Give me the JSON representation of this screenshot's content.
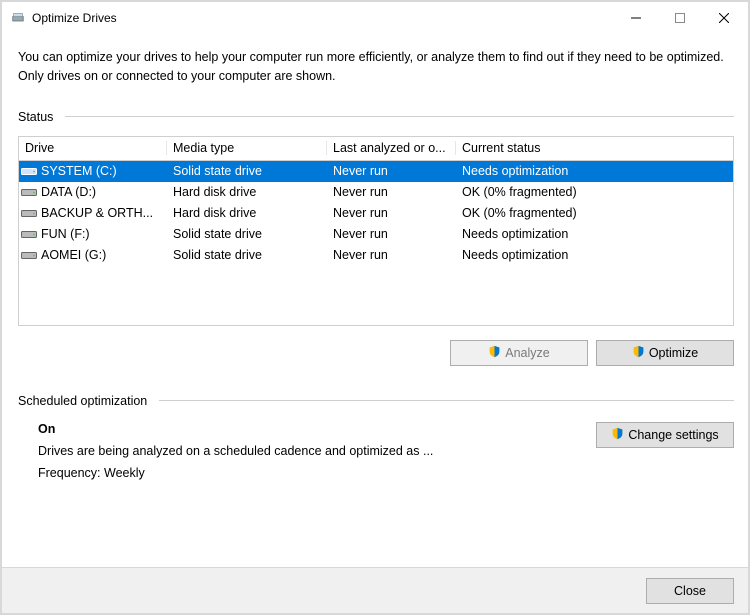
{
  "window": {
    "title": "Optimize Drives"
  },
  "description": "You can optimize your drives to help your computer run more efficiently, or analyze them to find out if they need to be optimized. Only drives on or connected to your computer are shown.",
  "sections": {
    "status_label": "Status",
    "scheduled_label": "Scheduled optimization"
  },
  "table": {
    "headers": {
      "drive": "Drive",
      "media": "Media type",
      "last": "Last analyzed or o...",
      "status": "Current status"
    },
    "rows": [
      {
        "name": "SYSTEM (C:)",
        "media": "Solid state drive",
        "last": "Never run",
        "status": "Needs optimization",
        "selected": true
      },
      {
        "name": "DATA (D:)",
        "media": "Hard disk drive",
        "last": "Never run",
        "status": "OK (0% fragmented)",
        "selected": false
      },
      {
        "name": "BACKUP & ORTH...",
        "media": "Hard disk drive",
        "last": "Never run",
        "status": "OK (0% fragmented)",
        "selected": false
      },
      {
        "name": "FUN (F:)",
        "media": "Solid state drive",
        "last": "Never run",
        "status": "Needs optimization",
        "selected": false
      },
      {
        "name": "AOMEI (G:)",
        "media": "Solid state drive",
        "last": "Never run",
        "status": "Needs optimization",
        "selected": false
      }
    ]
  },
  "buttons": {
    "analyze": "Analyze",
    "optimize": "Optimize",
    "change_settings": "Change settings",
    "close": "Close"
  },
  "schedule": {
    "on_label": "On",
    "description": "Drives are being analyzed on a scheduled cadence and optimized as ...",
    "frequency": "Frequency: Weekly"
  }
}
